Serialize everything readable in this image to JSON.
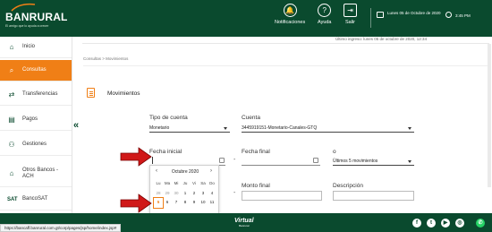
{
  "header": {
    "brand": "BANRURAL",
    "tagline": "El amigo que lo ayuda a crecer",
    "notifications_label": "Notificaciones",
    "help_label": "Ayuda",
    "exit_label": "Salir",
    "date_text": "Lunes 05 de Octubre de 2020",
    "time_text": "3:45 PM"
  },
  "last_login": "Último ingreso: lunes 05 de octubre de 2020, 12:34",
  "sidebar": {
    "items": [
      {
        "label": "Inicio"
      },
      {
        "label": "Consultas"
      },
      {
        "label": "Transferencias"
      },
      {
        "label": "Pagos"
      },
      {
        "label": "Gestiones"
      },
      {
        "label": "Otros Bancos - ACH"
      },
      {
        "label": "BancoSAT"
      }
    ]
  },
  "breadcrumb": "Consultas > Movimientos",
  "page_title": "Movimientos",
  "form": {
    "tipo_cuenta_label": "Tipo de cuenta",
    "tipo_cuenta_value": "Monetario",
    "cuenta_label": "Cuenta",
    "cuenta_value": "3445919151-Monetario-Canales-GTQ",
    "fecha_inicial_label": "Fecha inicial",
    "fecha_final_label": "Fecha final",
    "o_label": "o",
    "ultimos_value": "Últimos 5 movimientos",
    "monto_final_label": "Monto final",
    "descripcion_label": "Descripción"
  },
  "calendar": {
    "month_label": "Octubre 2020",
    "days_of_week": [
      "Lu",
      "Ma",
      "Mi",
      "Ju",
      "Vi",
      "Sa",
      "Do"
    ],
    "week1": [
      "28",
      "29",
      "30",
      "1",
      "2",
      "3",
      "4"
    ],
    "week2": [
      "5",
      "6",
      "7",
      "8",
      "9",
      "10",
      "11"
    ],
    "highlighted_day": "5"
  },
  "footer": {
    "logo_text": "Virtual",
    "logo_sub": "Banrural",
    "social": [
      "f",
      "t",
      "▶",
      "◎"
    ]
  },
  "status_url": "https://bancaff.banrural.com.gt/corp/pages/jsp/home/index.jsp#",
  "colors": {
    "primary_green": "#0a4a2e",
    "accent_orange": "#f07f16",
    "pointer_red": "#d01818"
  }
}
